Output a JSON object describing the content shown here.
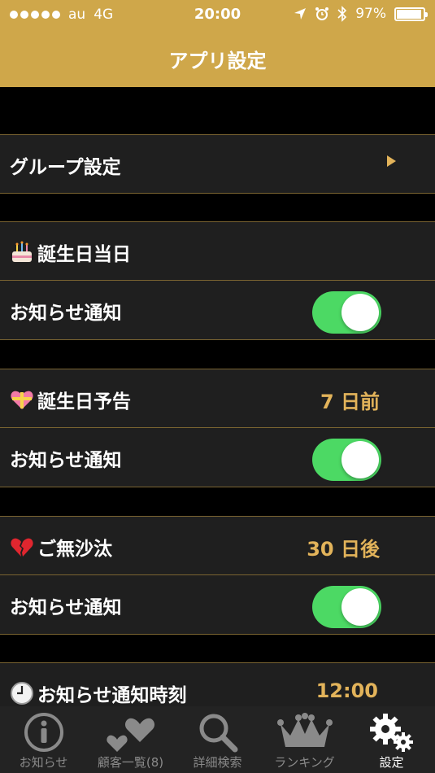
{
  "status": {
    "carrier": "au",
    "network": "4G",
    "time": "20:00",
    "battery": "97%"
  },
  "header": {
    "title": "アプリ設定"
  },
  "rows": {
    "group": {
      "label": "グループ設定"
    },
    "birthday": {
      "label": "誕生日当日",
      "icon": "birthday-cake-icon"
    },
    "birthday_notify": {
      "label": "お知らせ通知",
      "on": true
    },
    "preview": {
      "label": "誕生日予告",
      "icon": "gift-heart-icon",
      "value": "7 日前"
    },
    "preview_notify": {
      "label": "お知らせ通知",
      "on": true
    },
    "absence": {
      "label": "ご無沙汰",
      "icon": "broken-heart-icon",
      "value": "30 日後"
    },
    "absence_notify": {
      "label": "お知らせ通知",
      "on": true
    },
    "time": {
      "label": "お知らせ通知時刻",
      "icon": "clock-icon",
      "value": "12:00"
    }
  },
  "tabs": [
    {
      "label": "お知らせ",
      "icon": "info-icon"
    },
    {
      "label": "顧客一覧(8)",
      "icon": "hearts-icon"
    },
    {
      "label": "詳細検索",
      "icon": "search-icon"
    },
    {
      "label": "ランキング",
      "icon": "crown-icon"
    },
    {
      "label": "設定",
      "icon": "gears-icon",
      "active": true
    }
  ],
  "colors": {
    "header": "#cfa74a",
    "accent": "#e2b35a",
    "toggle_on": "#4cd964",
    "row": "#1f1f1f"
  }
}
